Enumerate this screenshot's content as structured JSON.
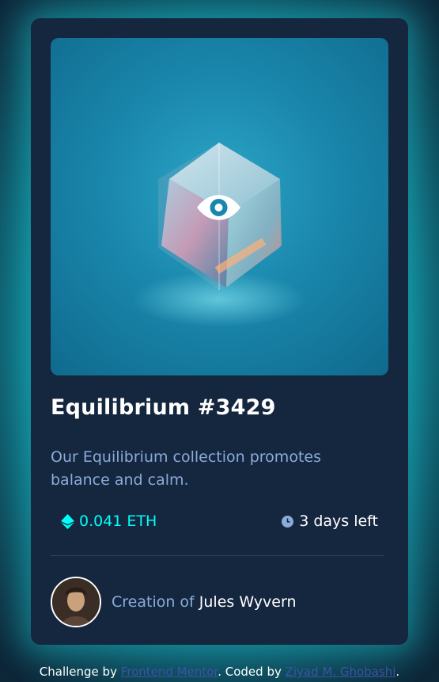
{
  "card": {
    "title": "Equilibrium #3429",
    "description": "Our Equilibrium collection promotes balance and calm.",
    "price": "0.041 ETH",
    "time_left": "3 days left",
    "creator_prefix": "Creation of ",
    "creator_name": "Jules Wyvern"
  },
  "attribution": {
    "prefix": "Challenge by ",
    "link1": "Frontend Mentor",
    "middle": ". Coded by ",
    "link2": "Ziyad M. Ghobashi",
    "suffix": "."
  },
  "icons": {
    "hero_overlay": "eye-icon",
    "price": "ethereum-icon",
    "time": "clock-icon"
  },
  "colors": {
    "card_bg": "#15263f",
    "accent_cyan": "#00fff7",
    "soft_blue": "#8bacd9",
    "link_blue": "#3e52a3",
    "white": "#ffffff"
  }
}
